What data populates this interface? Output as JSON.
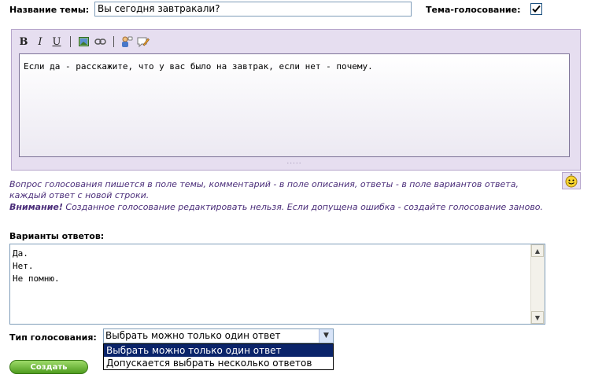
{
  "form": {
    "title_label": "Название темы:",
    "title_value": "Вы сегодня завтракали?",
    "poll_label": "Тема-голосование:",
    "poll_checked": true
  },
  "editor": {
    "toolbar": {
      "bold": "B",
      "italic": "I",
      "underline": "U",
      "icons": [
        "image-icon",
        "link-icon",
        "user-quote-icon",
        "edit-comment-icon"
      ]
    },
    "content": "Если да - расскажите, что у вас было на завтрак, если нет - почему.",
    "resize_grip": "....."
  },
  "notes": {
    "hint": "Вопрос голосования пишется в поле темы, комментарий - в поле описания, ответы - в поле вариантов ответа, каждый ответ с новой строки.",
    "warning_strong": "Внимание!",
    "warning": " Созданное голосование редактировать нельзя. Если допущена ошибка - создайте голосование заново."
  },
  "answers": {
    "label": "Варианты ответов:",
    "value": "Да.\nНет.\nНе помню."
  },
  "vote_type": {
    "label": "Тип голосования:",
    "selected": "Выбрать можно только один ответ",
    "options": [
      "Выбрать можно только один ответ",
      "Допускается выбрать несколько ответов"
    ]
  },
  "submit": {
    "label": "Создать"
  },
  "colors": {
    "note": "#4b2e7a",
    "editor_bg": "#e6def0",
    "button_green": "#4f9c1f",
    "select_highlight": "#0a246a"
  }
}
